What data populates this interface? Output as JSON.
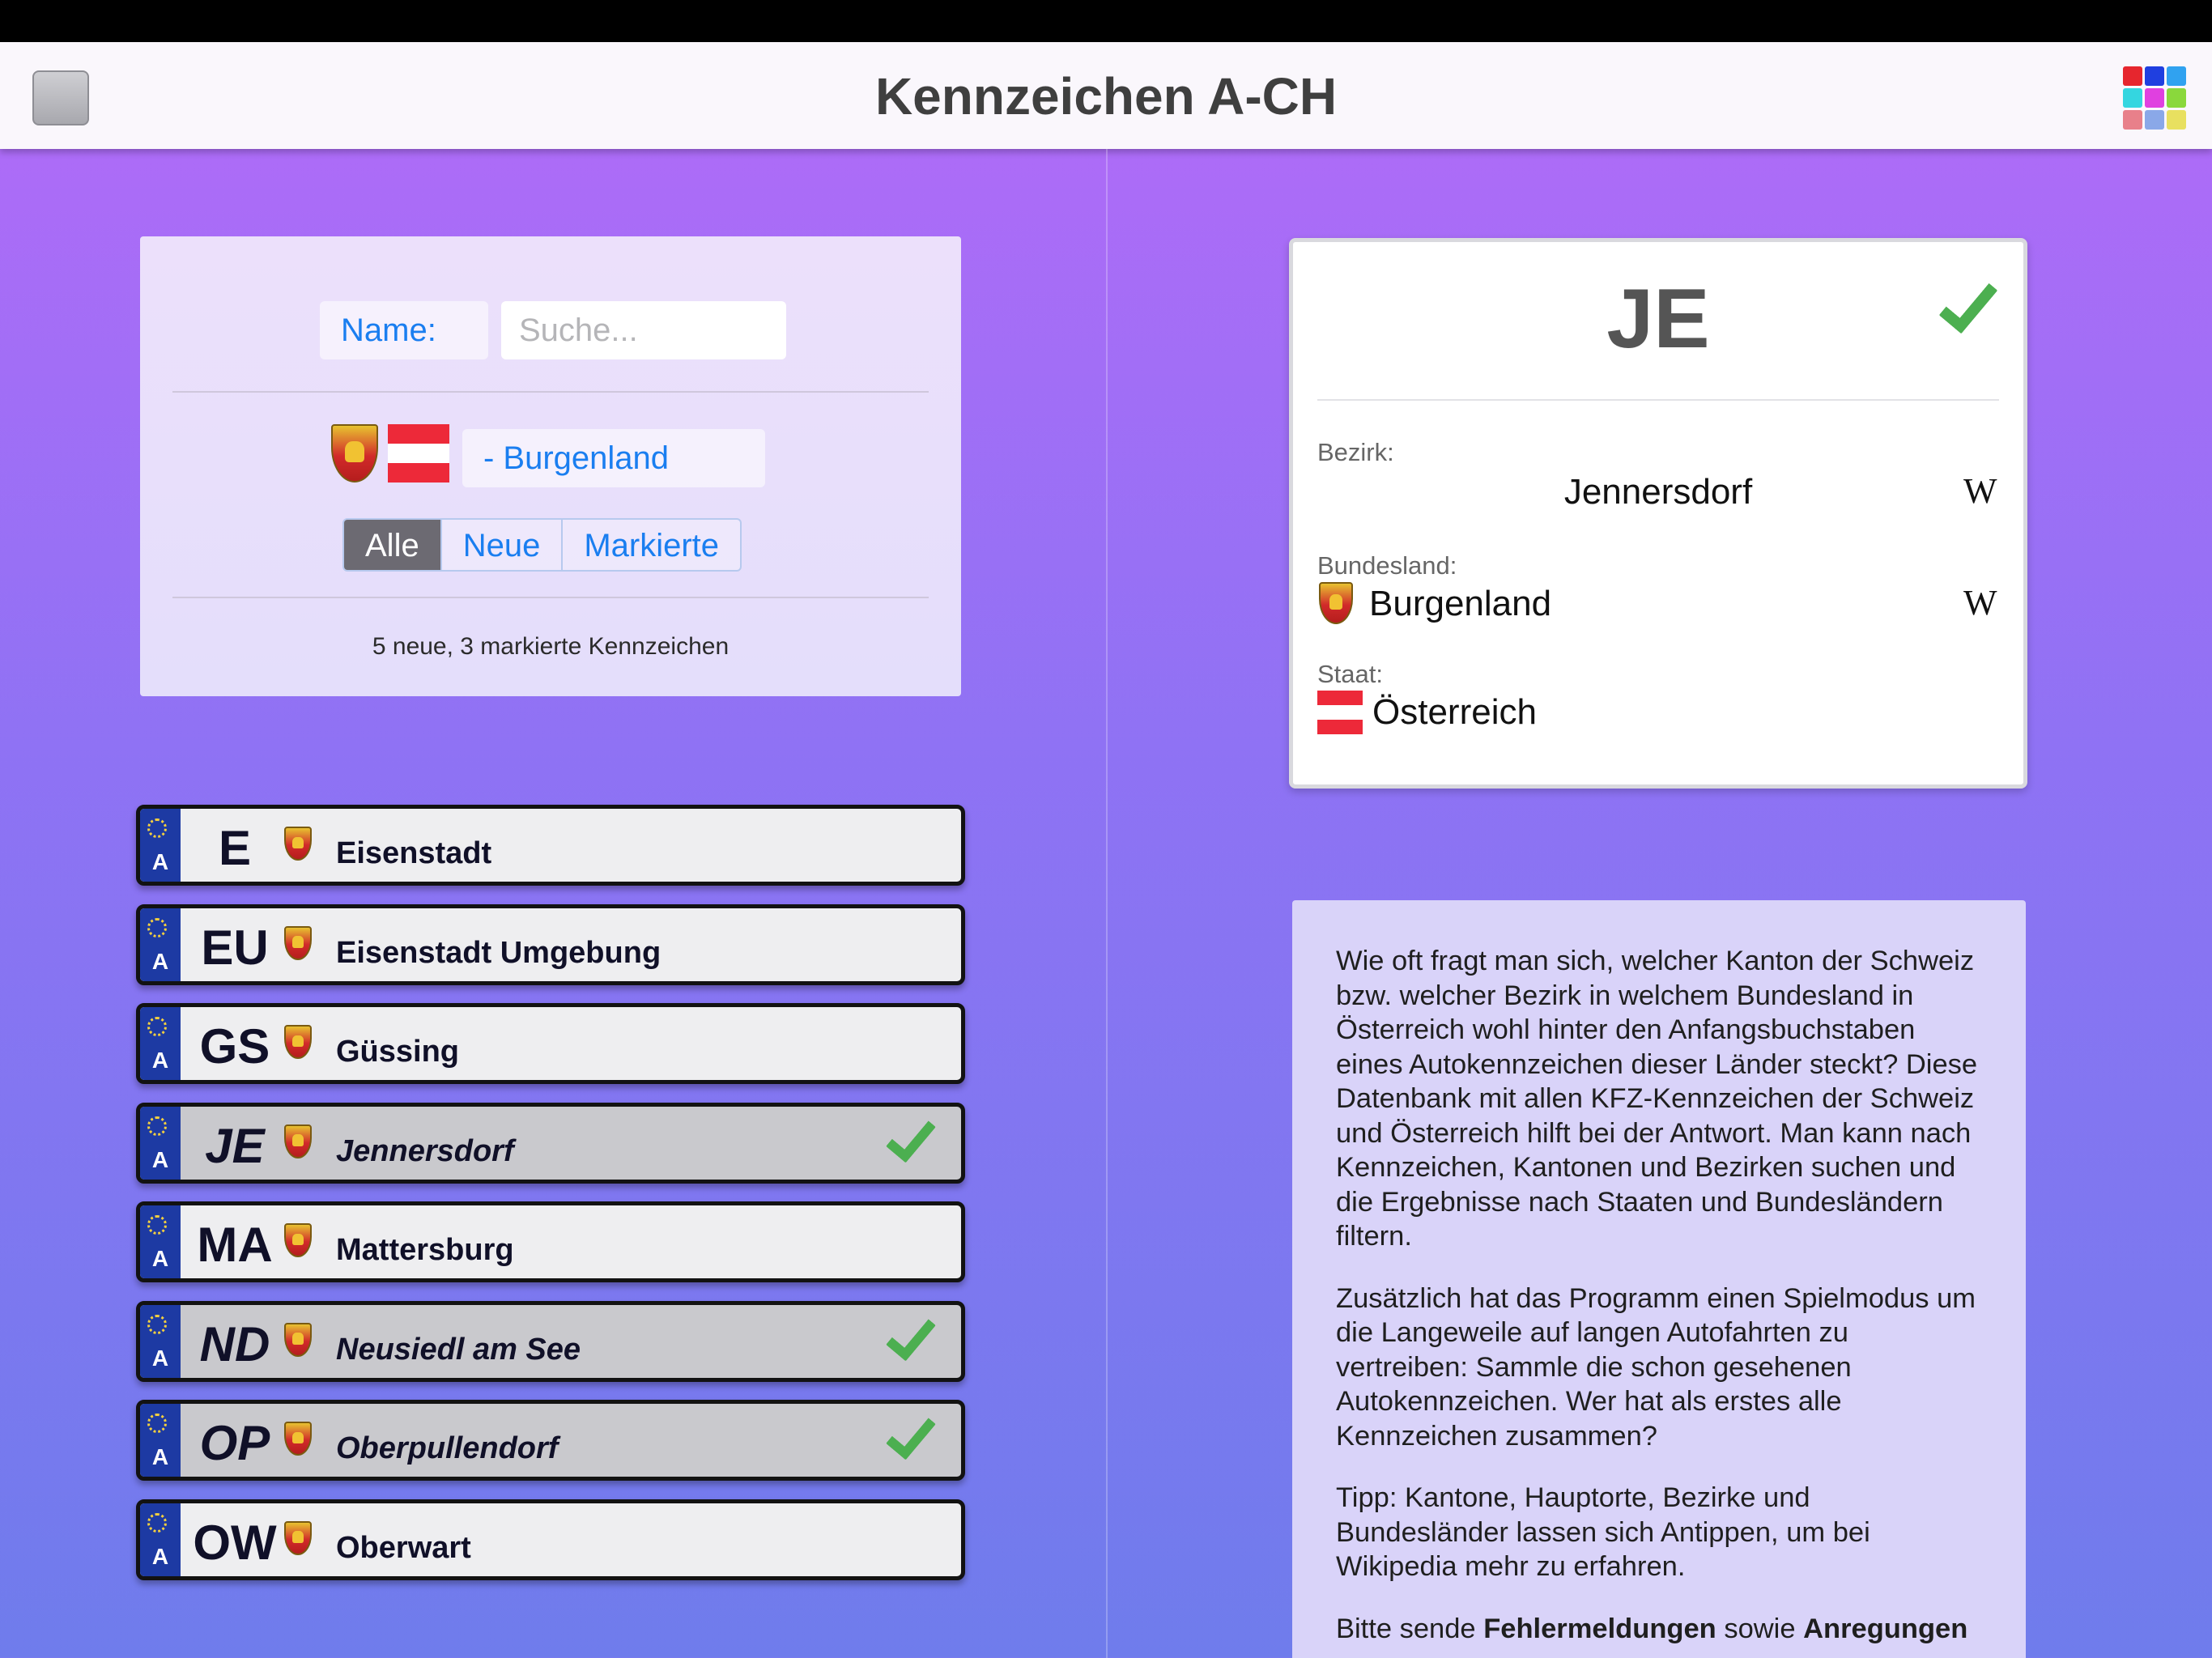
{
  "nav": {
    "title": "Kennzeichen A-CH"
  },
  "color_grid": [
    "#e6262e",
    "#1f3fe0",
    "#30a2f0",
    "#34d6e0",
    "#e040e0",
    "#8ad83c",
    "#e8808a",
    "#8aa8e8",
    "#e8e060"
  ],
  "filter": {
    "name_label": "Name:",
    "search_placeholder": "Suche...",
    "region": "- Burgenland",
    "segments": [
      "Alle",
      "Neue",
      "Markierte"
    ],
    "summary": "5 neue, 3 markierte Kennzeichen"
  },
  "plates": [
    {
      "country": "A",
      "code": "E",
      "name": "Eisenstadt",
      "marked": false
    },
    {
      "country": "A",
      "code": "EU",
      "name": "Eisenstadt Umgebung",
      "marked": false
    },
    {
      "country": "A",
      "code": "GS",
      "name": "Güssing",
      "marked": false
    },
    {
      "country": "A",
      "code": "JE",
      "name": "Jennersdorf",
      "marked": true
    },
    {
      "country": "A",
      "code": "MA",
      "name": "Mattersburg",
      "marked": false
    },
    {
      "country": "A",
      "code": "ND",
      "name": "Neusiedl am See",
      "marked": true
    },
    {
      "country": "A",
      "code": "OP",
      "name": "Oberpullendorf",
      "marked": true
    },
    {
      "country": "A",
      "code": "OW",
      "name": "Oberwart",
      "marked": false
    }
  ],
  "detail": {
    "code": "JE",
    "bezirk_label": "Bezirk:",
    "bezirk": "Jennersdorf",
    "bundesland_label": "Bundesland:",
    "bundesland": "Burgenland",
    "staat_label": "Staat:",
    "staat": "Österreich",
    "wiki_glyph": "W"
  },
  "info": {
    "p1": "Wie oft fragt man sich, welcher Kanton der Schweiz bzw. welcher Bezirk in welchem Bundesland in Österreich wohl hinter den Anfangsbuchstaben eines Autokennzeichen dieser Länder steckt? Diese Datenbank mit allen KFZ-Kennzeichen der Schweiz und Österreich hilft bei der Antwort. Man kann nach Kennzeichen, Kantonen und Bezirken suchen und die Ergebnisse nach Staaten und Bundesländern filtern.",
    "p2": "Zusätzlich hat das Programm einen Spielmodus um die Langeweile auf langen Autofahrten zu vertreiben: Sammle die schon gesehenen Autokennzeichen. Wer hat als erstes alle Kennzeichen zusammen?",
    "p3": "Tipp: Kantone, Hauptorte, Bezirke und Bundesländer lassen sich Antippen, um bei Wikipedia mehr zu erfahren.",
    "p4_a": "Bitte sende ",
    "p4_b": "Fehlermeldungen",
    "p4_c": " sowie ",
    "p4_d": "Anregungen"
  }
}
